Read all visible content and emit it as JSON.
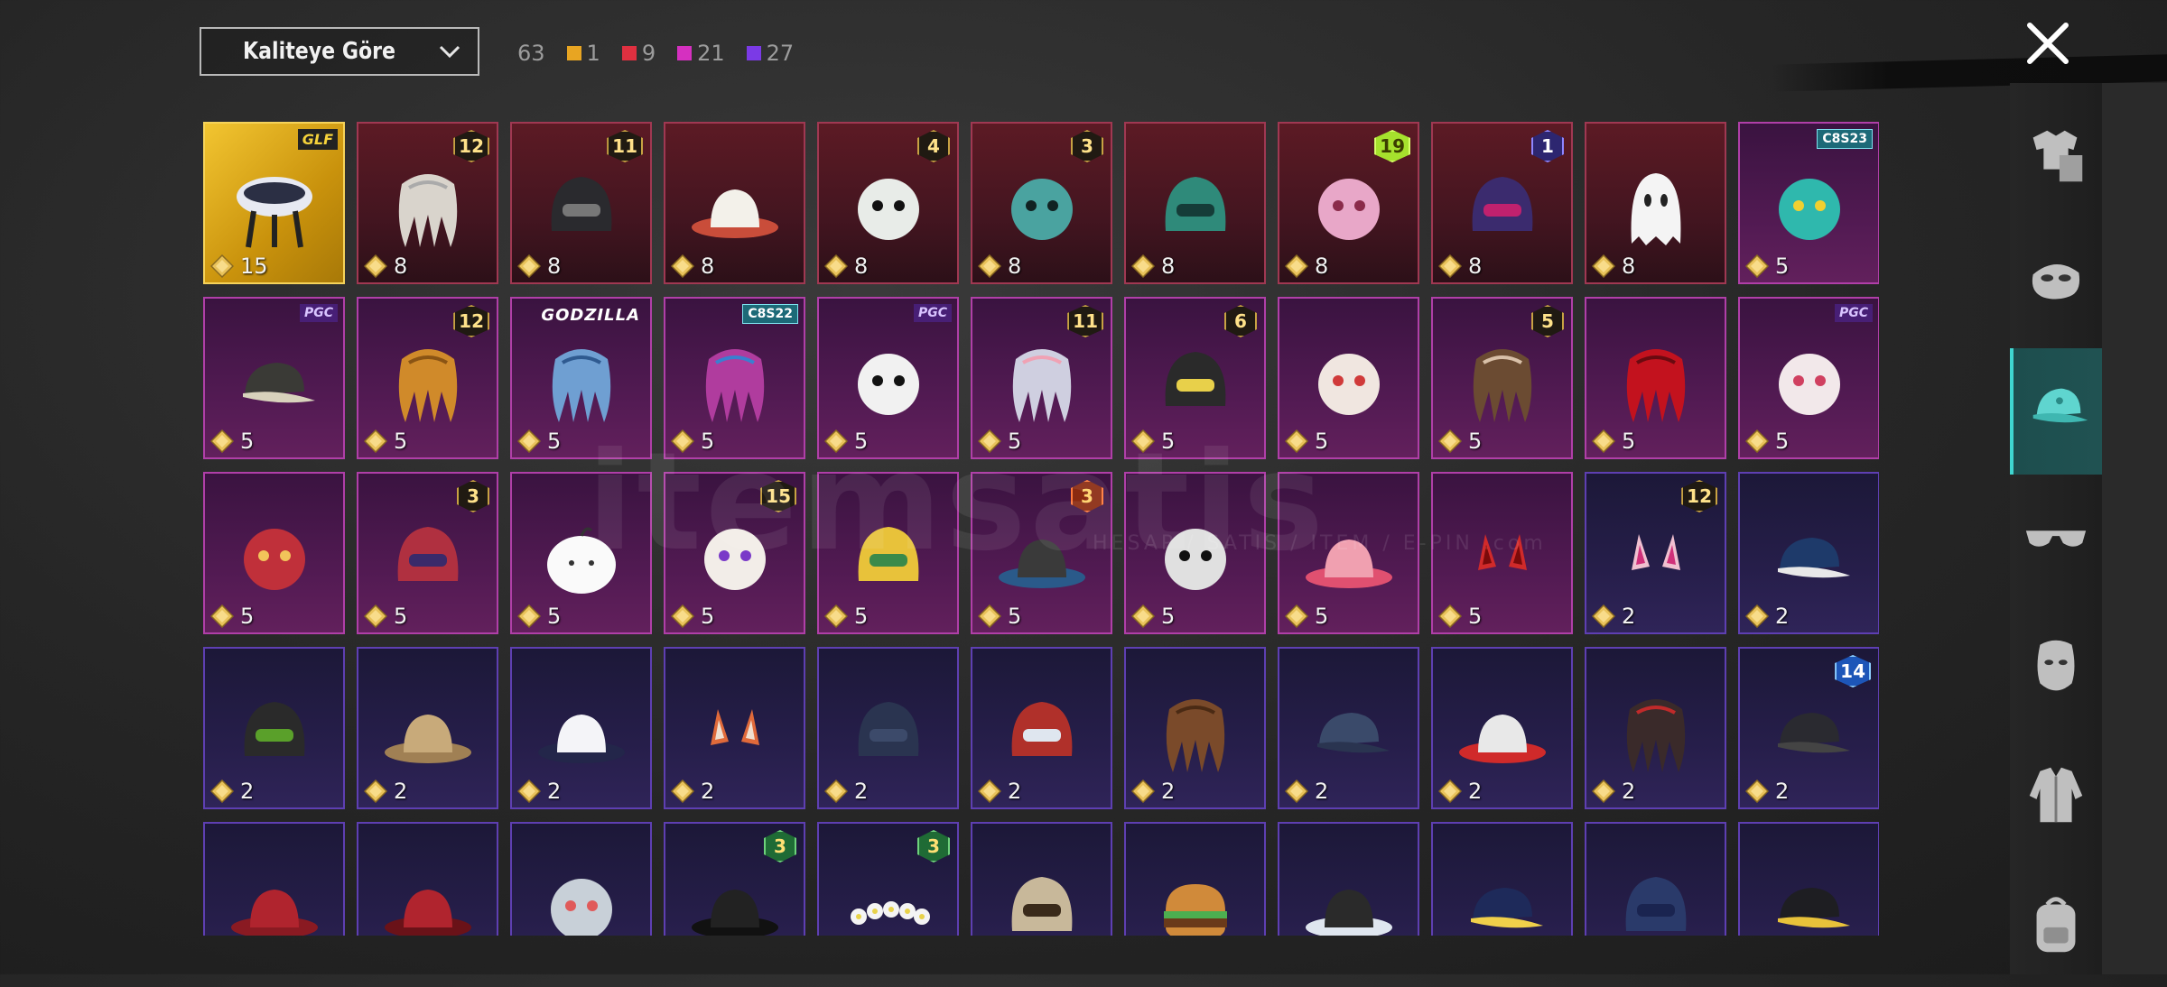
{
  "header": {
    "sort_label": "Kaliteye Göre",
    "total": "63",
    "counts": [
      {
        "value": "1",
        "color": "#e8a522"
      },
      {
        "value": "9",
        "color": "#e03040"
      },
      {
        "value": "21",
        "color": "#d530c0"
      },
      {
        "value": "27",
        "color": "#7b3ae6"
      }
    ]
  },
  "watermark": {
    "brand": "itemsatis",
    "sub": "HESAP / SATIS / ITEM / E-PIN",
    "domain": ".com"
  },
  "sidebar": {
    "tabs": [
      {
        "name": "outfit",
        "active": false
      },
      {
        "name": "mask",
        "active": false
      },
      {
        "name": "headwear",
        "active": true
      },
      {
        "name": "eyewear",
        "active": false
      },
      {
        "name": "face",
        "active": false
      },
      {
        "name": "jacket",
        "active": false
      },
      {
        "name": "backpack",
        "active": false
      }
    ]
  },
  "items": [
    {
      "rarity": "gold",
      "art": "egg-chair",
      "qty": "15",
      "tag_type": "gpro",
      "tag": "GLF"
    },
    {
      "rarity": "red",
      "art": "white-hair",
      "qty": "8",
      "badge": "12"
    },
    {
      "rarity": "red",
      "art": "dark-helmet",
      "qty": "8",
      "badge": "11"
    },
    {
      "rarity": "red",
      "art": "white-hat",
      "qty": "8"
    },
    {
      "rarity": "red",
      "art": "snowman-tophat",
      "qty": "8",
      "badge": "4"
    },
    {
      "rarity": "red",
      "art": "zombie-head",
      "qty": "8",
      "badge": "3"
    },
    {
      "rarity": "red",
      "art": "dragon-helmet",
      "qty": "8"
    },
    {
      "rarity": "red",
      "art": "pink-demon",
      "qty": "8",
      "badge": "19",
      "badge_style": "lime"
    },
    {
      "rarity": "red",
      "art": "purple-helmet",
      "qty": "8",
      "badge": "1",
      "badge_style": "violet"
    },
    {
      "rarity": "red",
      "art": "ghost",
      "qty": "8"
    },
    {
      "rarity": "pink",
      "art": "cat-headphones",
      "qty": "5",
      "tag_type": "season",
      "tag": "C8S23"
    },
    {
      "rarity": "pink",
      "art": "camo-cap",
      "qty": "5",
      "tag_type": "pgc",
      "tag": "PGC"
    },
    {
      "rarity": "pink",
      "art": "orange-hair",
      "qty": "5",
      "badge": "12"
    },
    {
      "rarity": "pink",
      "art": "blue-hair",
      "qty": "5",
      "tag_type": "godz",
      "tag": "GODZILLA"
    },
    {
      "rarity": "pink",
      "art": "purple-hair",
      "qty": "5",
      "tag_type": "season",
      "tag": "C8S22"
    },
    {
      "rarity": "pink",
      "art": "panda",
      "qty": "5",
      "tag_type": "pgc",
      "tag": "PGC"
    },
    {
      "rarity": "pink",
      "art": "flower-hair",
      "qty": "5",
      "badge": "11"
    },
    {
      "rarity": "pink",
      "art": "knight-helmet",
      "qty": "5",
      "badge": "6"
    },
    {
      "rarity": "pink",
      "art": "lion-head",
      "qty": "5"
    },
    {
      "rarity": "pink",
      "art": "bunny-hair",
      "qty": "5",
      "badge": "5"
    },
    {
      "rarity": "pink",
      "art": "red-hair",
      "qty": "5"
    },
    {
      "rarity": "pink",
      "art": "bear-head",
      "qty": "5",
      "tag_type": "pgc",
      "tag": "PGC"
    },
    {
      "rarity": "pink",
      "art": "dragon-mask",
      "qty": "5"
    },
    {
      "rarity": "pink",
      "art": "jester-hat",
      "qty": "5",
      "badge": "3"
    },
    {
      "rarity": "pink",
      "art": "dumpling",
      "qty": "5"
    },
    {
      "rarity": "pink",
      "art": "bird-head",
      "qty": "5",
      "badge": "15"
    },
    {
      "rarity": "pink",
      "art": "duck-helmet",
      "qty": "5"
    },
    {
      "rarity": "pink",
      "art": "straw-hat",
      "qty": "5",
      "badge": "3",
      "badge_style": "orange"
    },
    {
      "rarity": "pink",
      "art": "zebra",
      "qty": "5"
    },
    {
      "rarity": "pink",
      "art": "pink-hat",
      "qty": "5"
    },
    {
      "rarity": "pink",
      "art": "horns",
      "qty": "5"
    },
    {
      "rarity": "purple",
      "art": "bunny-ears",
      "qty": "2",
      "badge": "12"
    },
    {
      "rarity": "purple",
      "art": "blue-cap",
      "qty": "2"
    },
    {
      "rarity": "purple",
      "art": "gas-mask",
      "qty": "2"
    },
    {
      "rarity": "purple",
      "art": "safari-hat",
      "qty": "2"
    },
    {
      "rarity": "purple",
      "art": "sun-hat",
      "qty": "2"
    },
    {
      "rarity": "purple",
      "art": "cat-ears",
      "qty": "2"
    },
    {
      "rarity": "purple",
      "art": "beanie",
      "qty": "2"
    },
    {
      "rarity": "purple",
      "art": "red-helmet",
      "qty": "2"
    },
    {
      "rarity": "purple",
      "art": "brown-hair",
      "qty": "2"
    },
    {
      "rarity": "purple",
      "art": "grey-cap",
      "qty": "2"
    },
    {
      "rarity": "purple",
      "art": "bandana-hat",
      "qty": "2"
    },
    {
      "rarity": "purple",
      "art": "bun-hair",
      "qty": "2"
    },
    {
      "rarity": "purple",
      "art": "officer-cap",
      "qty": "2",
      "badge": "14",
      "badge_style": "blue"
    },
    {
      "rarity": "purple",
      "art": "beret",
      "qty": ""
    },
    {
      "rarity": "purple",
      "art": "fedora-red",
      "qty": ""
    },
    {
      "rarity": "purple",
      "art": "shark",
      "qty": ""
    },
    {
      "rarity": "purple",
      "art": "black-fedora",
      "qty": "",
      "badge": "3",
      "badge_style": "green"
    },
    {
      "rarity": "purple",
      "art": "flower-crown",
      "qty": "",
      "badge": "3",
      "badge_style": "green"
    },
    {
      "rarity": "purple",
      "art": "knit-hat",
      "qty": ""
    },
    {
      "rarity": "purple",
      "art": "burger",
      "qty": ""
    },
    {
      "rarity": "purple",
      "art": "head-mirror",
      "qty": ""
    },
    {
      "rarity": "purple",
      "art": "pilot-cap",
      "qty": ""
    },
    {
      "rarity": "purple",
      "art": "navy-hat",
      "qty": ""
    },
    {
      "rarity": "purple",
      "art": "black-cap",
      "qty": ""
    }
  ]
}
